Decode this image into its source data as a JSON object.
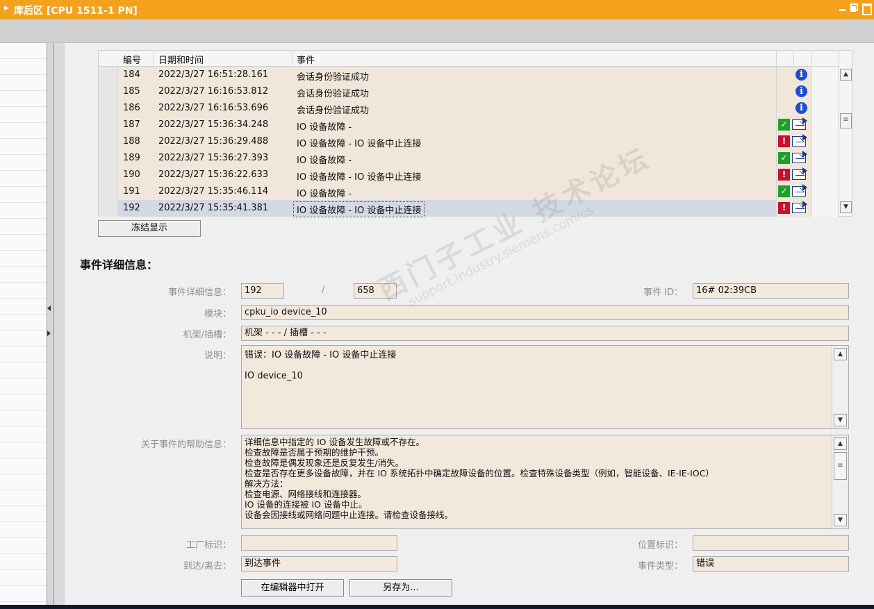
{
  "window": {
    "title": "库后区 [CPU 1511-1 PN]"
  },
  "event_table": {
    "columns": {
      "no": "编号",
      "datetime": "日期和时间",
      "event": "事件"
    },
    "rows": [
      {
        "no": "184",
        "datetime": "2022/3/27 16:51:28.161",
        "event": "会话身份验证成功",
        "icon": "info-icon"
      },
      {
        "no": "185",
        "datetime": "2022/3/27 16:16:53.812",
        "event": "会话身份验证成功",
        "icon": "info-icon"
      },
      {
        "no": "186",
        "datetime": "2022/3/27 16:16:53.696",
        "event": "会话身份验证成功",
        "icon": "info-icon"
      },
      {
        "no": "187",
        "datetime": "2022/3/27 15:36:34.248",
        "event": "IO 设备故障 -",
        "icon": "ok-check-icon"
      },
      {
        "no": "188",
        "datetime": "2022/3/27 15:36:29.488",
        "event": "IO 设备故障 - IO 设备中止连接",
        "icon": "error-wrench-icon"
      },
      {
        "no": "189",
        "datetime": "2022/3/27 15:36:27.393",
        "event": "IO 设备故障 -",
        "icon": "ok-check-icon"
      },
      {
        "no": "190",
        "datetime": "2022/3/27 15:36:22.633",
        "event": "IO 设备故障 - IO 设备中止连接",
        "icon": "error-wrench-icon"
      },
      {
        "no": "191",
        "datetime": "2022/3/27 15:35:46.114",
        "event": "IO 设备故障 -",
        "icon": "ok-check-icon"
      },
      {
        "no": "192",
        "datetime": "2022/3/27 15:35:41.381",
        "event": "IO 设备故障 - IO 设备中止连接",
        "icon": "error-wrench-icon",
        "selected": true
      }
    ]
  },
  "freeze_button": "冻结显示",
  "details": {
    "section_title": "事件详细信息：",
    "labels": {
      "detail": "事件详细信息：",
      "event_id": "事件 ID：",
      "module": "模块：",
      "rack_slot": "机架/插槽：",
      "description": "说明：",
      "help": "关于事件的帮助信息：",
      "plant_id": "工厂标识：",
      "location_id": "位置标识：",
      "arrive_leave": "到达/离去：",
      "event_type": "事件类型："
    },
    "values": {
      "current": "192",
      "separator": "/",
      "total": "658",
      "event_id": "16# 02:39CB",
      "module": "cpku_io device_10",
      "rack_slot": "机架 - - - / 插槽 - - -",
      "description_lines": [
        "错误：IO 设备故障 - IO 设备中止连接",
        "",
        " IO device_10"
      ],
      "help_lines": [
        "详细信息中指定的 IO 设备发生故障或不存在。",
        "检查故障是否属于预期的维护干预。",
        "检查故障是偶发现象还是反复发生/消失。",
        "检查是否存在更多设备故障，并在 IO 系统拓扑中确定故障设备的位置。检查特殊设备类型（例如，智能设备、IE-IE-IOC）",
        "解决方法：",
        "检查电源、网络接线和连接器。",
        " IO 设备的连接被 IO 设备中止。",
        "设备会因接线或网络问题中止连接。请检查设备接线。"
      ],
      "plant_id": "",
      "location_id": "",
      "arrive_leave": "到达事件",
      "event_type": "错误"
    }
  },
  "buttons": {
    "open_in_editor": "在编辑器中打开",
    "save_as": "另存为..."
  },
  "watermark": {
    "line1": "西门子工业 技术论坛",
    "line2": "support.industry.siemens.com/cs"
  },
  "colors": {
    "titlebar": "#f4a21c",
    "field_bg": "#f2e8dc",
    "info": "#1a4fd0",
    "ok": "#1e9f2a",
    "error": "#c8102e"
  }
}
